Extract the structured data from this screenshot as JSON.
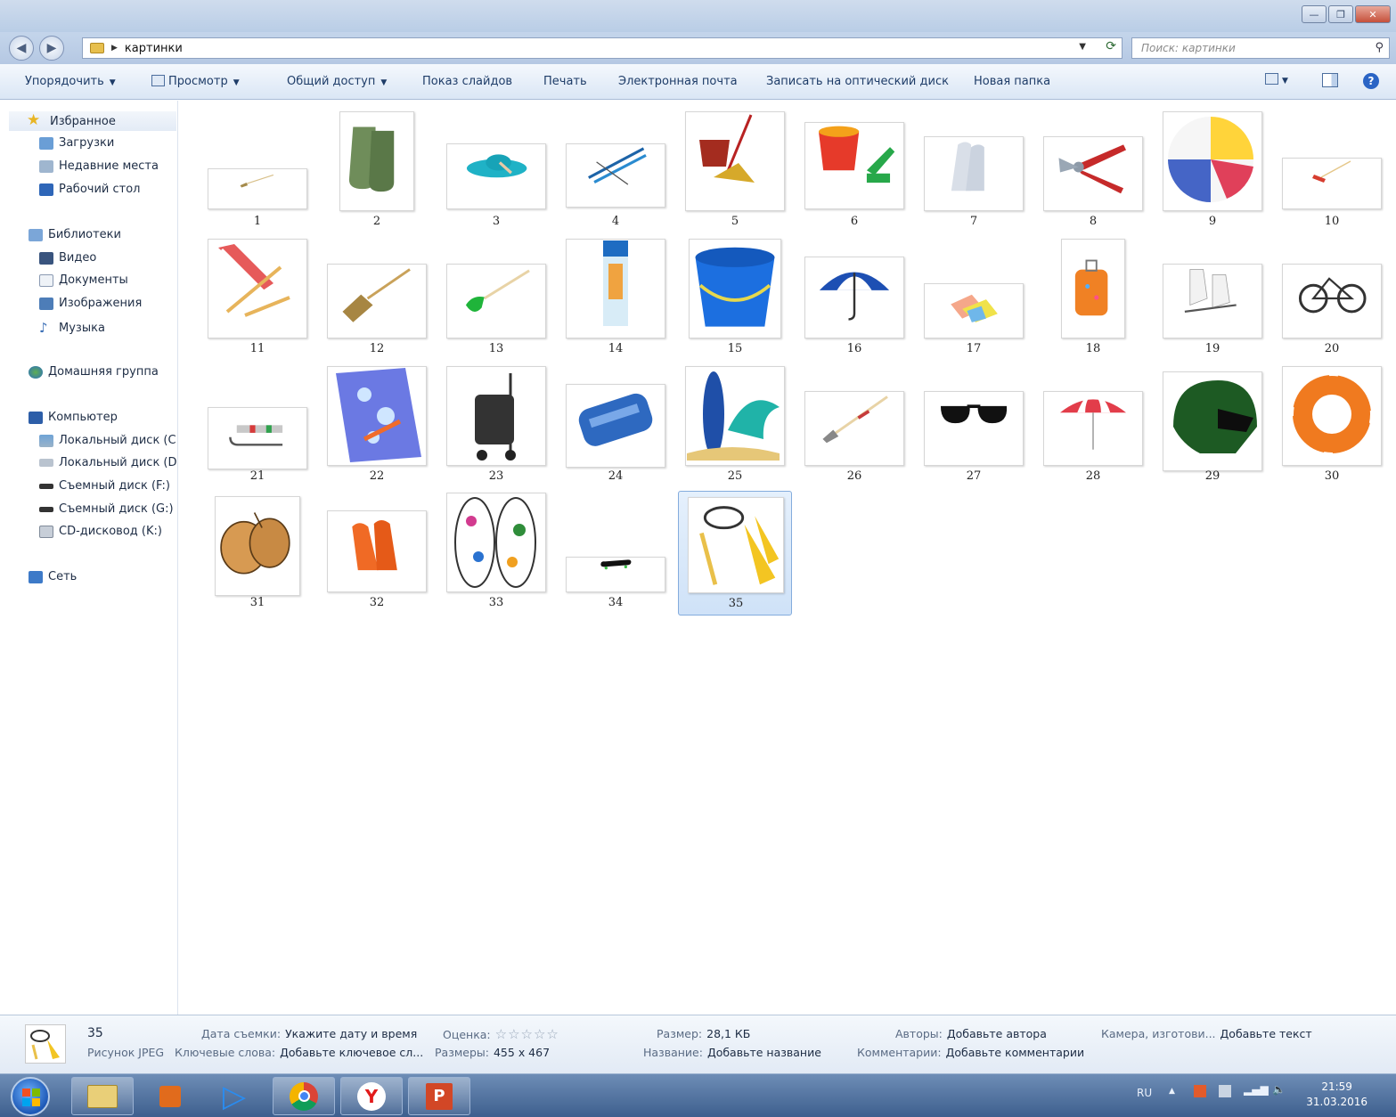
{
  "window": {
    "minimize": "—",
    "maximize": "❐",
    "close": "✕"
  },
  "address": {
    "folder": "картинки",
    "search_placeholder": "Поиск: картинки"
  },
  "toolbar": {
    "organize": "Упорядочить",
    "view": "Просмотр",
    "share": "Общий доступ",
    "slideshow": "Показ слайдов",
    "print": "Печать",
    "email": "Электронная почта",
    "burn": "Записать на оптический диск",
    "new_folder": "Новая папка"
  },
  "nav": {
    "favorites": "Избранное",
    "downloads": "Загрузки",
    "recent": "Недавние места",
    "desktop": "Рабочий стол",
    "libraries": "Библиотеки",
    "video": "Видео",
    "documents": "Документы",
    "images": "Изображения",
    "music": "Музыка",
    "homegroup": "Домашняя группа",
    "computer": "Компьютер",
    "local_c": "Локальный диск (C",
    "local_d": "Локальный диск (D",
    "removable_f": "Съемный диск (F:)",
    "removable_g": "Съемный диск (G:)",
    "cd_k": "CD-дисковод (K:)",
    "network": "Сеть"
  },
  "files": [
    {
      "label": "1",
      "icon": "broom-icon"
    },
    {
      "label": "2",
      "icon": "rubber-boots-icon"
    },
    {
      "label": "3",
      "icon": "sun-hat-icon"
    },
    {
      "label": "4",
      "icon": "skis-icon"
    },
    {
      "label": "5",
      "icon": "bucket-mop-icon"
    },
    {
      "label": "6",
      "icon": "sand-pail-icon"
    },
    {
      "label": "7",
      "icon": "gloves-icon"
    },
    {
      "label": "8",
      "icon": "pruner-icon"
    },
    {
      "label": "9",
      "icon": "beach-ball-icon"
    },
    {
      "label": "10",
      "icon": "rake-icon"
    },
    {
      "label": "11",
      "icon": "deck-chair-icon"
    },
    {
      "label": "12",
      "icon": "besom-icon"
    },
    {
      "label": "13",
      "icon": "shovel-icon"
    },
    {
      "label": "14",
      "icon": "sunscreen-tube-icon"
    },
    {
      "label": "15",
      "icon": "blue-bucket-icon"
    },
    {
      "label": "16",
      "icon": "umbrella-icon"
    },
    {
      "label": "17",
      "icon": "cloths-icon"
    },
    {
      "label": "18",
      "icon": "suitcase-icon"
    },
    {
      "label": "19",
      "icon": "ice-skates-icon"
    },
    {
      "label": "20",
      "icon": "bicycle-icon"
    },
    {
      "label": "21",
      "icon": "sled-icon"
    },
    {
      "label": "22",
      "icon": "beach-towel-icon"
    },
    {
      "label": "23",
      "icon": "shopping-trolley-icon"
    },
    {
      "label": "24",
      "icon": "air-mattress-icon"
    },
    {
      "label": "25",
      "icon": "surfboard-icon"
    },
    {
      "label": "26",
      "icon": "hoe-icon"
    },
    {
      "label": "27",
      "icon": "sunglasses-icon"
    },
    {
      "label": "28",
      "icon": "beach-umbrella-icon"
    },
    {
      "label": "29",
      "icon": "helmet-icon"
    },
    {
      "label": "30",
      "icon": "lifebuoy-icon"
    },
    {
      "label": "31",
      "icon": "boxing-gloves-icon"
    },
    {
      "label": "32",
      "icon": "rubber-gloves-icon"
    },
    {
      "label": "33",
      "icon": "flip-flops-icon"
    },
    {
      "label": "34",
      "icon": "skateboard-icon"
    },
    {
      "label": "35",
      "icon": "snorkel-flippers-icon"
    }
  ],
  "selected": "35",
  "details": {
    "name": "35",
    "type": "Рисунок JPEG",
    "date_key": "Дата съемки:",
    "date_val": "Укажите дату и время",
    "tags_key": "Ключевые слова:",
    "tags_val": "Добавьте ключевое сл...",
    "rating_key": "Оценка:",
    "rating_val": "☆☆☆☆☆",
    "dims_key": "Размеры:",
    "dims_val": "455 x 467",
    "size_key": "Размер:",
    "size_val": "28,1 КБ",
    "title_key": "Название:",
    "title_val": "Добавьте название",
    "authors_key": "Авторы:",
    "authors_val": "Добавьте автора",
    "comments_key": "Комментарии:",
    "comments_val": "Добавьте комментарии",
    "camera_key": "Камера, изготови...",
    "camera_val": "Добавьте текст"
  },
  "taskbar": {
    "lang": "RU",
    "time": "21:59",
    "date": "31.03.2016"
  },
  "colors": {
    "accent": "#2a64c5",
    "selection": "#cfe2f8",
    "taskbar": "#3e5f8e"
  }
}
